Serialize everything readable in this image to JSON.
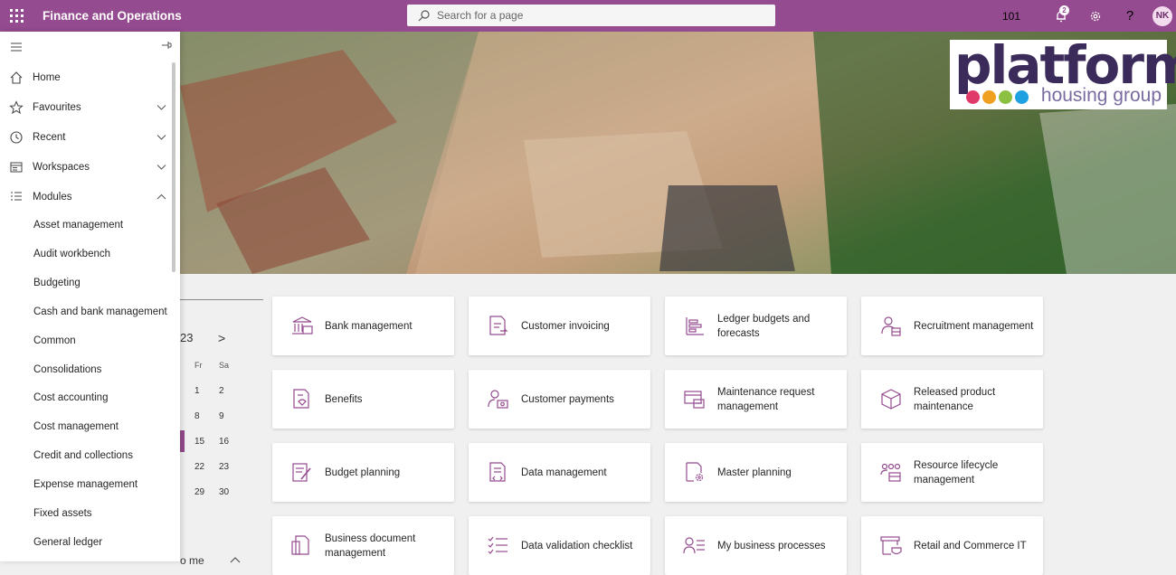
{
  "header": {
    "app_title": "Finance and Operations",
    "search_placeholder": "Search for a page",
    "company": "101",
    "notification_count": "2",
    "user_initials": "NK",
    "accent_color": "#944b8f"
  },
  "sidebar": {
    "items": [
      {
        "label": "Home",
        "icon": "home-icon"
      },
      {
        "label": "Favourites",
        "icon": "star-icon"
      },
      {
        "label": "Recent",
        "icon": "clock-icon"
      },
      {
        "label": "Workspaces",
        "icon": "workspace-icon"
      },
      {
        "label": "Modules",
        "icon": "list-icon"
      }
    ],
    "modules": [
      "Asset management",
      "Audit workbench",
      "Budgeting",
      "Cash and bank management",
      "Common",
      "Consolidations",
      "Cost accounting",
      "Cost management",
      "Credit and collections",
      "Expense management",
      "Fixed assets",
      "General ledger"
    ]
  },
  "banner": {
    "logo_text": "platform",
    "logo_subtext": "housing group",
    "logo_dot_colors": [
      "#e03a6a",
      "#f0a020",
      "#8cc040",
      "#1fa0e0"
    ]
  },
  "calendar": {
    "month_fragment": "23",
    "next_arrow": ">",
    "day_headers": [
      "Fr",
      "Sa"
    ],
    "rows": [
      [
        "1",
        "2"
      ],
      [
        "8",
        "9"
      ],
      [
        "15",
        "16"
      ],
      [
        "22",
        "23"
      ],
      [
        "29",
        "30"
      ]
    ],
    "bottom_fragment": "o me"
  },
  "tiles": [
    {
      "label": "Bank management",
      "icon": "bank-icon"
    },
    {
      "label": "Customer invoicing",
      "icon": "invoice-icon"
    },
    {
      "label": "Ledger budgets and forecasts",
      "icon": "ledger-icon"
    },
    {
      "label": "Recruitment management",
      "icon": "recruitment-icon"
    },
    {
      "label": "Benefits",
      "icon": "benefits-icon"
    },
    {
      "label": "Customer payments",
      "icon": "payments-icon"
    },
    {
      "label": "Maintenance request management",
      "icon": "maintenance-icon"
    },
    {
      "label": "Released product maintenance",
      "icon": "product-box-icon"
    },
    {
      "label": "Budget planning",
      "icon": "budget-planning-icon"
    },
    {
      "label": "Data management",
      "icon": "data-management-icon"
    },
    {
      "label": "Master planning",
      "icon": "master-planning-icon"
    },
    {
      "label": "Resource lifecycle management",
      "icon": "resource-icon"
    },
    {
      "label": "Business document management",
      "icon": "document-icon"
    },
    {
      "label": "Data validation checklist",
      "icon": "checklist-icon"
    },
    {
      "label": "My business processes",
      "icon": "processes-icon"
    },
    {
      "label": "Retail and Commerce IT",
      "icon": "retail-icon"
    }
  ]
}
